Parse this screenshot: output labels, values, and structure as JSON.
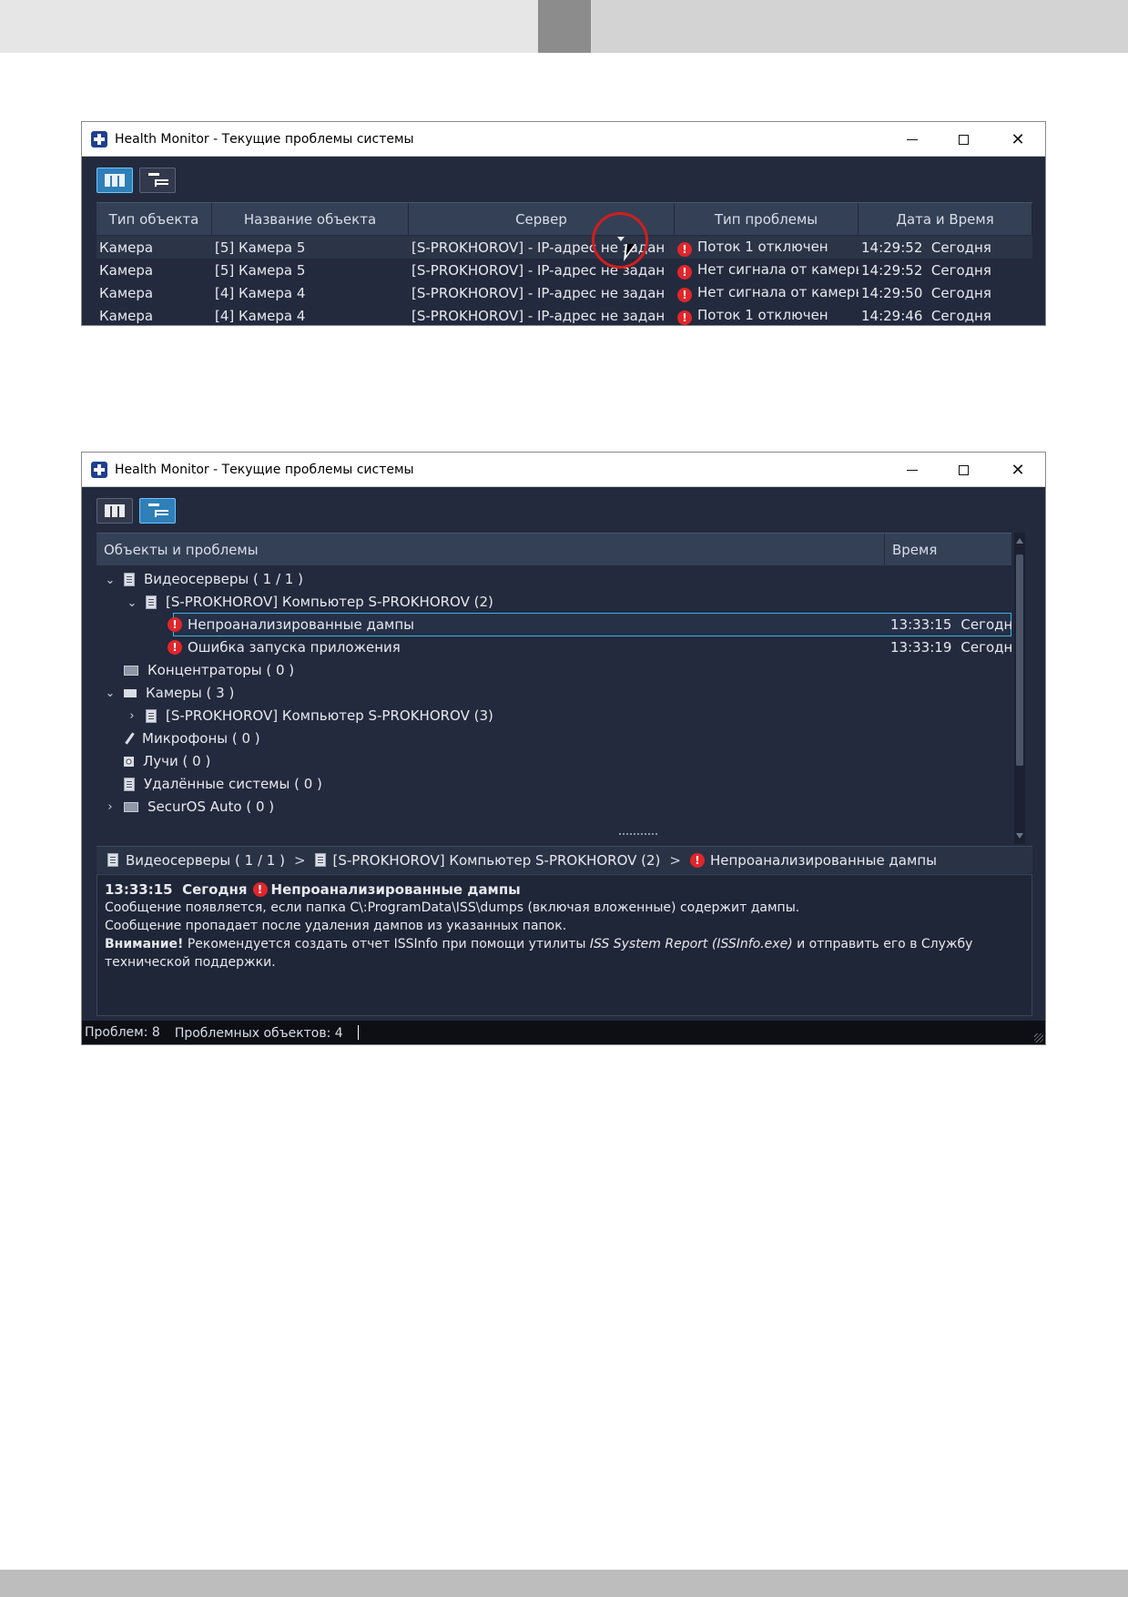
{
  "window1": {
    "title": "Health Monitor - Текущие проблемы системы",
    "columns": [
      "Тип объекта",
      "Название объекта",
      "Сервер",
      "Тип проблемы",
      "Дата и Время"
    ],
    "rows": [
      {
        "type": "Камера",
        "name": "[5] Камера 5",
        "server": "[S-PROKHOROV] - IP-адрес не задан",
        "problem": "Поток 1 отключен",
        "time": "14:29:52",
        "day": "Сегодня"
      },
      {
        "type": "Камера",
        "name": "[5] Камера 5",
        "server": "[S-PROKHOROV] - IP-адрес не задан",
        "problem": "Нет сигнала от камеры",
        "time": "14:29:52",
        "day": "Сегодня"
      },
      {
        "type": "Камера",
        "name": "[4] Камера 4",
        "server": "[S-PROKHOROV] - IP-адрес не задан",
        "problem": "Нет сигнала от камеры",
        "time": "14:29:50",
        "day": "Сегодня"
      },
      {
        "type": "Камера",
        "name": "[4] Камера 4",
        "server": "[S-PROKHOROV] - IP-адрес не задан",
        "problem": "Поток 1 отключен",
        "time": "14:29:46",
        "day": "Сегодня"
      }
    ]
  },
  "window2": {
    "title": "Health Monitor - Текущие проблемы системы",
    "tree_header": {
      "objects": "Объекты и проблемы",
      "time": "Время"
    },
    "tree": {
      "videoservers": "Видеосерверы ( 1 / 1 )",
      "computer2": "[S-PROKHOROV] Компьютер S-PROKHOROV (2)",
      "problem1": "Непроанализированные дампы",
      "problem1_time": "13:33:15",
      "problem1_day": "Сегодня",
      "problem2": "Ошибка запуска приложения",
      "problem2_time": "13:33:19",
      "problem2_day": "Сегодня",
      "hubs": "Концентраторы ( 0 )",
      "cameras": "Камеры ( 3 )",
      "computer3": "[S-PROKHOROV] Компьютер S-PROKHOROV (3)",
      "mics": "Микрофоны ( 0 )",
      "rays": "Лучи ( 0 )",
      "remote": "Удалённые системы ( 0 )",
      "auto": "SecurOS Auto ( 0 )"
    },
    "breadcrumb": {
      "level1": "Видеосерверы ( 1 / 1 )",
      "level2": "[S-PROKHOROV] Компьютер S-PROKHOROV (2)",
      "level3": "Непроанализированные дампы",
      "separator": ">"
    },
    "details": {
      "time": "13:33:15",
      "day": "Сегодня",
      "title": "Непроанализированные дампы",
      "line1": "Сообщение появляется, если папка C\\:ProgramData\\ISS\\dumps (включая вложенные) содержит дампы.",
      "line2": "Сообщение пропадает после удаления дампов из указанных папок.",
      "warn_label": "Внимание!",
      "warn_text1": " Рекомендуется создать отчет ISSInfo при помощи утилиты ",
      "warn_tool": "ISS System Report (ISSInfo.exe)",
      "warn_text2": " и отправить его в Службу технической поддержки."
    },
    "status": {
      "problems": "Проблем: 8",
      "objects": "Проблемных объектов: 4"
    }
  },
  "colors": {
    "window_bg": "#232a3d",
    "header_bg": "#344056",
    "alert": "#e0262b",
    "selection": "#3cb3e8",
    "active_toggle": "#2f7fb8"
  },
  "icons": {
    "app": "health-monitor-cross-icon",
    "alert": "exclamation-icon",
    "server": "server-icon",
    "camera": "camera-icon",
    "microphone": "microphone-icon",
    "ray": "ray-icon",
    "hub": "hub-icon"
  }
}
